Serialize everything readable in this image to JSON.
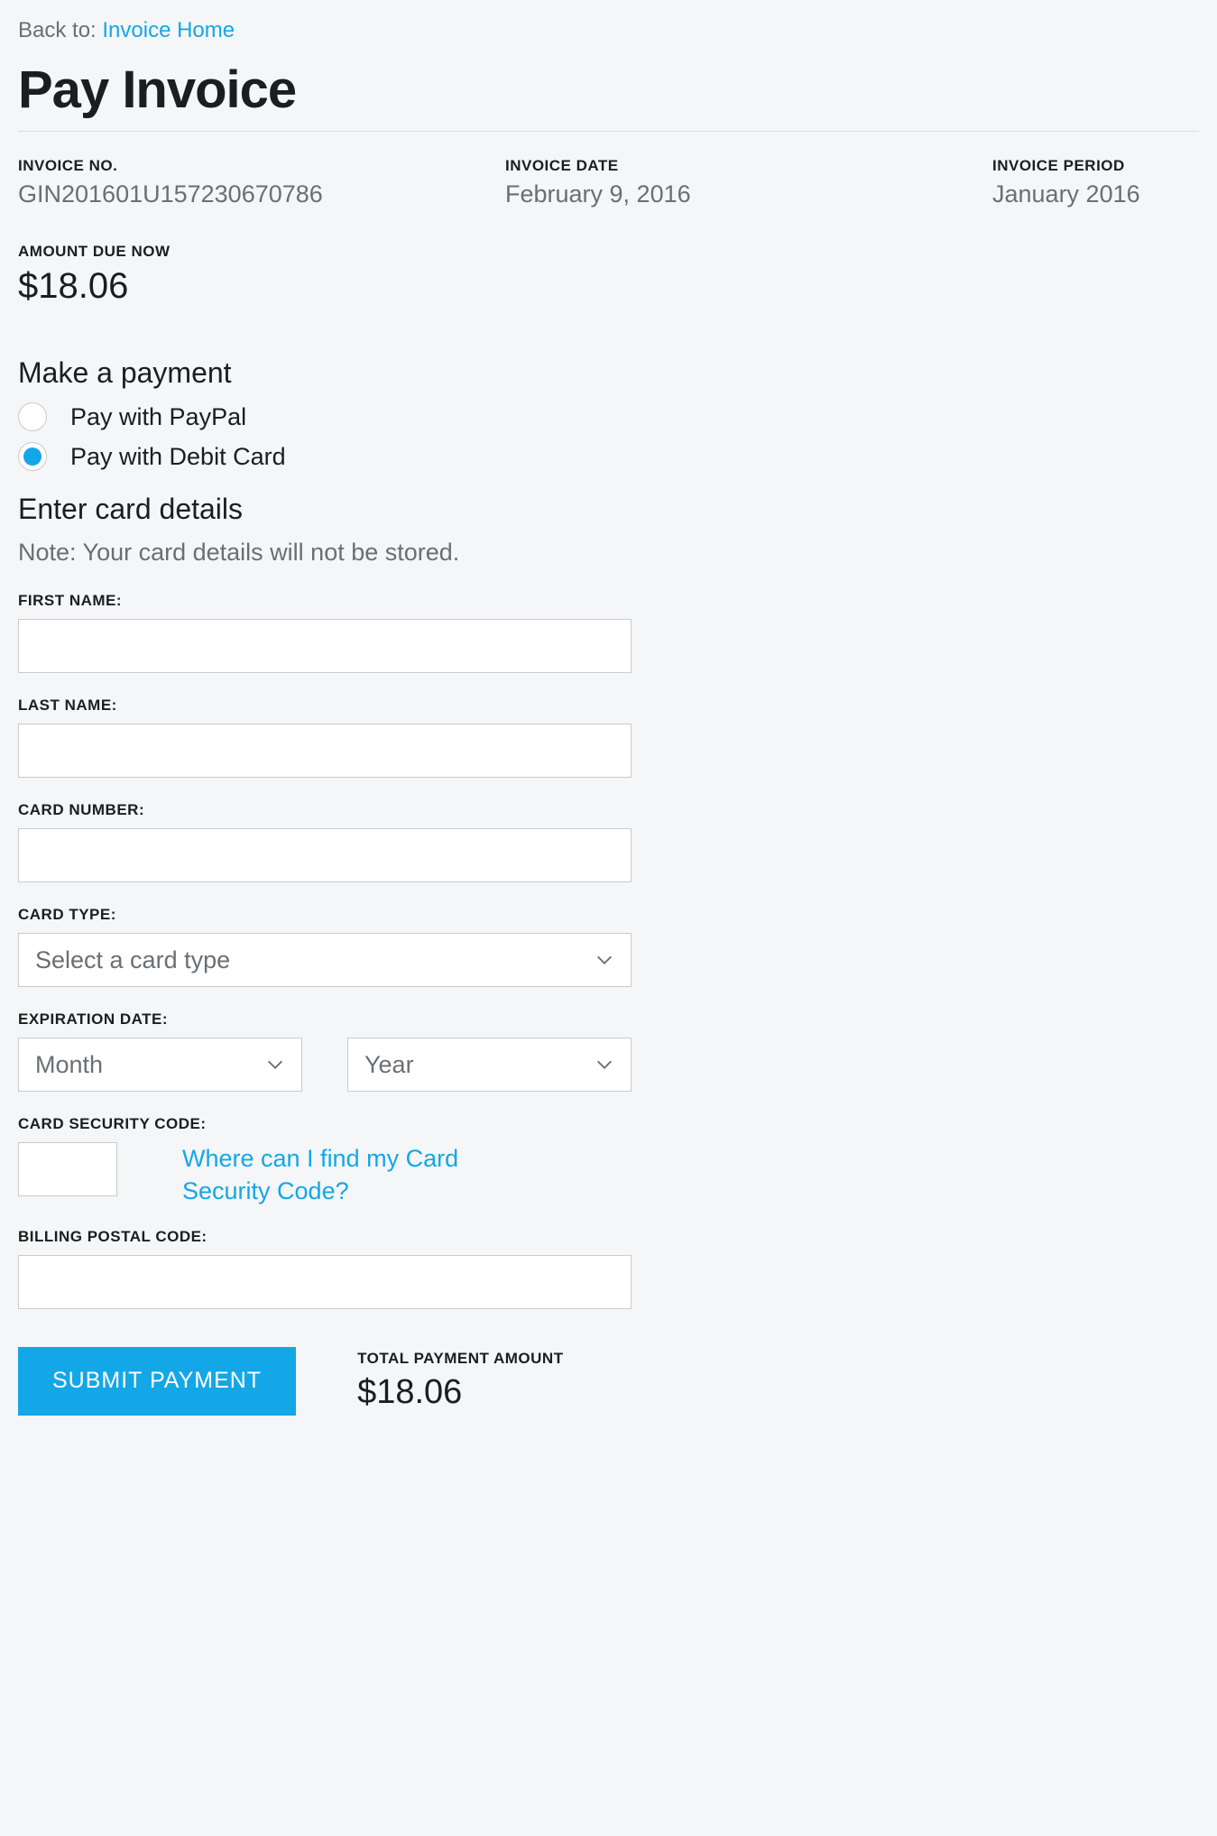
{
  "back": {
    "prefix": "Back to: ",
    "link_text": "Invoice Home"
  },
  "page_title": "Pay Invoice",
  "meta": {
    "invoice_no_label": "INVOICE NO.",
    "invoice_no_value": "GIN201601U157230670786",
    "invoice_date_label": "INVOICE DATE",
    "invoice_date_value": "February 9, 2016",
    "invoice_period_label": "INVOICE PERIOD",
    "invoice_period_value": "January 2016"
  },
  "amount_due": {
    "label": "AMOUNT DUE NOW",
    "value": "$18.06"
  },
  "payment": {
    "heading": "Make a payment",
    "options": [
      {
        "label": "Pay with PayPal",
        "selected": false
      },
      {
        "label": "Pay with Debit Card",
        "selected": true
      }
    ]
  },
  "card_section": {
    "heading": "Enter card details",
    "note": "Note: Your card details will not be stored."
  },
  "fields": {
    "first_name_label": "FIRST NAME:",
    "last_name_label": "LAST NAME:",
    "card_number_label": "CARD NUMBER:",
    "card_type_label": "CARD TYPE:",
    "card_type_placeholder": "Select a card type",
    "expiration_label": "EXPIRATION DATE:",
    "month_placeholder": "Month",
    "year_placeholder": "Year",
    "csc_label": "CARD SECURITY CODE:",
    "csc_help_link": "Where can I find my Card Security Code?",
    "postal_label": "BILLING POSTAL CODE:"
  },
  "submit": {
    "button_label": "SUBMIT PAYMENT",
    "total_label": "TOTAL PAYMENT AMOUNT",
    "total_value": "$18.06"
  }
}
